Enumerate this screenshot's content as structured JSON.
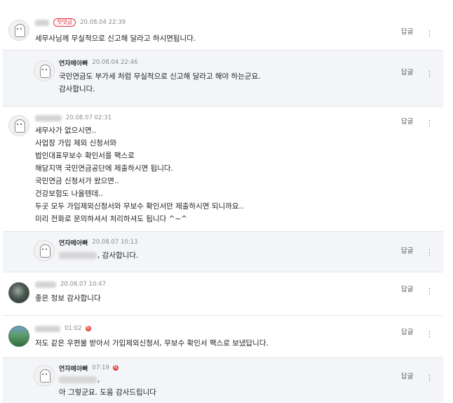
{
  "comments": [
    {
      "nick": "",
      "badge": "첫댓글",
      "date": "20.08.04 22:39",
      "lines": [
        "세무사님께 무실적으로 신고해 달라고 하시면됩니다."
      ],
      "reply_label": "답글"
    },
    {
      "nick": "연자메아빠",
      "date": "20.08.04 22:46",
      "lines": [
        "국민연금도 부가세 처럼 무실적으로 신고해 달라고 해야 하는군요.",
        "감사합니다."
      ],
      "reply_label": "답글"
    },
    {
      "nick": "",
      "date": "20.08.07 02:31",
      "lines": [
        "세무사가 없으시면..",
        "사업장 가입 제외 신청서와",
        "법인대표무보수 확인서를 팩스로",
        "해당지역 국민연금공단에 제출하시면 됩니다.",
        "국민연금 신청서가 왔으면..",
        "건강보험도 나올텐데..",
        "두곳 모두 가입제외신청서와 무보수 확인서만 제출하시면 되니까요..",
        "미리 전화로 문의하셔서 처리하셔도 됩니다 ^~^"
      ],
      "reply_label": "답글"
    },
    {
      "nick": "연자메아빠",
      "date": "20.08.07 10:13",
      "lines": [
        ", 감사합니다."
      ],
      "reply_label": "답글"
    },
    {
      "nick": "",
      "date": "20.08.07 10:47",
      "lines": [
        "좋은 정보 감사합니다"
      ],
      "reply_label": "답글"
    },
    {
      "nick": "",
      "date": "01:02",
      "lines": [
        "저도 같은 우편물 받아서 가입제외신청서, 무보수 확인서 팩스로 보냈답니다."
      ],
      "reply_label": "답글"
    },
    {
      "nick": "연자메아빠",
      "date": "07:19",
      "lines": [
        ",",
        "아 그렇군요. 도움 감사드립니다"
      ],
      "reply_label": "답글"
    }
  ],
  "new_badge_symbol": "N",
  "icons": {
    "more": "more-vertical-icon",
    "ghost_avatar": "ghost-avatar-icon"
  },
  "colors": {
    "reply_background": "#f3f5f8",
    "badge_red": "#e0323c",
    "new_dot": "#e8453c"
  }
}
